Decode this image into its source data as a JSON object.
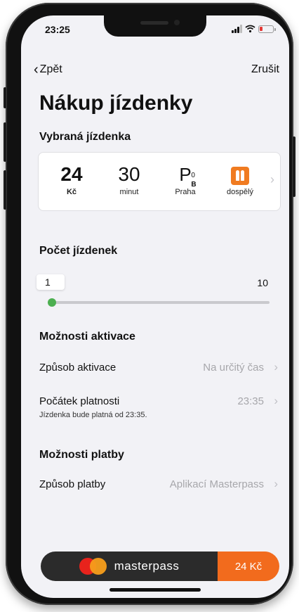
{
  "status_bar": {
    "time": "23:25"
  },
  "nav": {
    "back_label": "Zpět",
    "cancel_label": "Zrušit"
  },
  "title": "Nákup jízdenky",
  "selected_ticket": {
    "heading": "Vybraná jízdenka",
    "price": {
      "value": "24",
      "unit": "Kč"
    },
    "duration": {
      "value": "30",
      "unit": "minut"
    },
    "zone": {
      "letter": "P",
      "superscript": "0",
      "subscript": "B",
      "label": "Praha"
    },
    "passenger": {
      "icon": "person-pair-icon",
      "label": "dospělý"
    }
  },
  "quantity": {
    "heading": "Počet jízdenek",
    "current": "1",
    "max": "10",
    "fraction": 0
  },
  "activation": {
    "heading": "Možnosti aktivace",
    "method_label": "Způsob aktivace",
    "method_value": "Na určitý čas",
    "start_label": "Počátek platnosti",
    "start_value": "23:35",
    "start_note": "Jízdenka bude platná od 23:35."
  },
  "payment": {
    "heading": "Možnosti platby",
    "method_label": "Způsob platby",
    "method_value": "Aplikací Masterpass"
  },
  "pay_button": {
    "brand": "masterpass",
    "amount": "24 Kč"
  },
  "colors": {
    "accent": "#f26b1d",
    "slider": "#4caf50",
    "pay_dark": "#2b2b2b"
  }
}
